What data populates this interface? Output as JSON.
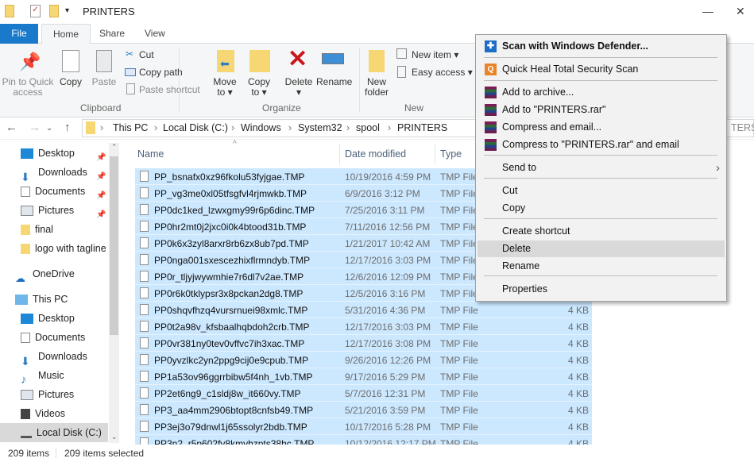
{
  "window": {
    "title": "PRINTERS",
    "minimize": "—",
    "close": "✕"
  },
  "ribbon_tabs": [
    "File",
    "Home",
    "Share",
    "View"
  ],
  "ribbon": {
    "pin": "Pin to Quick access",
    "copy": "Copy",
    "paste": "Paste",
    "cut": "Cut",
    "copy_path": "Copy path",
    "paste_shortcut": "Paste shortcut",
    "clipboard": "Clipboard",
    "move_to": "Move to",
    "copy_to": "Copy to",
    "delete": "Delete",
    "rename": "Rename",
    "organize": "Organize",
    "new_folder": "New folder",
    "new_item": "New item",
    "easy_access": "Easy access",
    "new": "New"
  },
  "address": {
    "crumbs": [
      "This PC",
      "Local Disk (C:)",
      "Windows",
      "System32",
      "spool",
      "PRINTERS"
    ],
    "search_fragment": "TERS"
  },
  "sidebar": {
    "quick": [
      "Desktop",
      "Downloads",
      "Documents",
      "Pictures",
      "final",
      "logo with tagline"
    ],
    "onedrive": "OneDrive",
    "thispc": "This PC",
    "pc_items": [
      "Desktop",
      "Documents",
      "Downloads",
      "Music",
      "Pictures",
      "Videos",
      "Local Disk (C:)"
    ]
  },
  "columns": {
    "name": "Name",
    "date": "Date modified",
    "type": "Type"
  },
  "files": [
    {
      "name": "PP_bsnafx0xz96fkolu53fyjgae.TMP",
      "date": "10/19/2016 4:59 PM",
      "type": "TMP File",
      "size": ""
    },
    {
      "name": "PP_vg3me0xl05tfsgfvl4rjmwkb.TMP",
      "date": "6/9/2016 3:12 PM",
      "type": "TMP File",
      "size": ""
    },
    {
      "name": "PP0dc1ked_lzwxgmy99r6p6dinc.TMP",
      "date": "7/25/2016 3:11 PM",
      "type": "TMP File",
      "size": ""
    },
    {
      "name": "PP0hr2mt0j2jxc0i0k4btood31b.TMP",
      "date": "7/11/2016 12:56 PM",
      "type": "TMP File",
      "size": ""
    },
    {
      "name": "PP0k6x3zyl8arxr8rb6zx8ub7pd.TMP",
      "date": "1/21/2017 10:42 AM",
      "type": "TMP File",
      "size": ""
    },
    {
      "name": "PP0nga001sxescezhixflrmndyb.TMP",
      "date": "12/17/2016 3:03 PM",
      "type": "TMP File",
      "size": ""
    },
    {
      "name": "PP0r_tljyjwywmhie7r6dl7v2ae.TMP",
      "date": "12/6/2016 12:09 PM",
      "type": "TMP File",
      "size": ""
    },
    {
      "name": "PP0r6k0tklypsr3x8pckan2dg8.TMP",
      "date": "12/5/2016 3:16 PM",
      "type": "TMP File",
      "size": ""
    },
    {
      "name": "PP0shqvfhzq4vursrnuei98xmlc.TMP",
      "date": "5/31/2016 4:36 PM",
      "type": "TMP File",
      "size": "4 KB"
    },
    {
      "name": "PP0t2a98v_kfsbaalhqbdoh2crb.TMP",
      "date": "12/17/2016 3:03 PM",
      "type": "TMP File",
      "size": "4 KB"
    },
    {
      "name": "PP0vr381ny0tev0vffvc7ih3xac.TMP",
      "date": "12/17/2016 3:08 PM",
      "type": "TMP File",
      "size": "4 KB"
    },
    {
      "name": "PP0yvzlkc2yn2ppg9cij0e9cpub.TMP",
      "date": "9/26/2016 12:26 PM",
      "type": "TMP File",
      "size": "4 KB"
    },
    {
      "name": "PP1a53ov96ggrrbibw5f4nh_1vb.TMP",
      "date": "9/17/2016 5:29 PM",
      "type": "TMP File",
      "size": "4 KB"
    },
    {
      "name": "PP2et6ng9_c1sldj8w_it660vy.TMP",
      "date": "5/7/2016 12:31 PM",
      "type": "TMP File",
      "size": "4 KB"
    },
    {
      "name": "PP3_aa4mm2906btopt8cnfsb49.TMP",
      "date": "5/21/2016 3:59 PM",
      "type": "TMP File",
      "size": "4 KB"
    },
    {
      "name": "PP3ej3o79dnwl1j65ssolyr2bdb.TMP",
      "date": "10/17/2016 5:28 PM",
      "type": "TMP File",
      "size": "4 KB"
    },
    {
      "name": "PP3n2_r5p602fv8kmvhzpts38hc.TMP",
      "date": "10/12/2016 12:17 PM",
      "type": "TMP File",
      "size": "4 KB"
    }
  ],
  "status": {
    "count": "209 items",
    "selected": "209 items selected"
  },
  "context_menu": [
    {
      "label": "Scan with Windows Defender...",
      "icon": "defender-icon"
    },
    {
      "label": "Quick Heal Total Security Scan",
      "icon": "quickheal-icon"
    },
    {
      "label": "Add to archive...",
      "icon": "winrar-icon"
    },
    {
      "label": "Add to \"PRINTERS.rar\"",
      "icon": "winrar-icon"
    },
    {
      "label": "Compress and email...",
      "icon": "winrar-icon"
    },
    {
      "label": "Compress to \"PRINTERS.rar\" and email",
      "icon": "winrar-icon"
    },
    {
      "label": "Send to"
    },
    {
      "label": "Cut"
    },
    {
      "label": "Copy"
    },
    {
      "label": "Create shortcut"
    },
    {
      "label": "Delete"
    },
    {
      "label": "Rename"
    },
    {
      "label": "Properties"
    }
  ],
  "colors": {
    "selection": "#cce8ff",
    "file_tab": "#1979ca",
    "menu_highlight": "#d9d9d9"
  }
}
